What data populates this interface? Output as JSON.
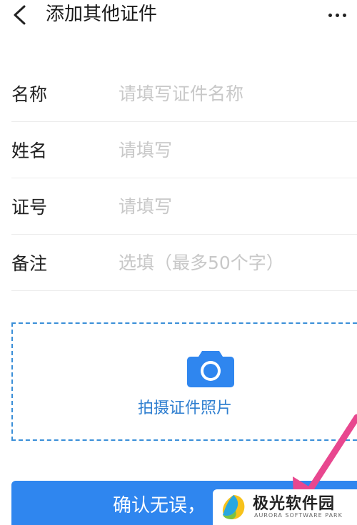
{
  "header": {
    "title": "添加其他证件"
  },
  "form": {
    "fields": [
      {
        "label": "名称",
        "placeholder": "请填写证件名称"
      },
      {
        "label": "姓名",
        "placeholder": "请填写"
      },
      {
        "label": "证号",
        "placeholder": "请填写"
      },
      {
        "label": "备注",
        "placeholder": "选填（最多50个字）"
      }
    ]
  },
  "photo": {
    "label": "拍摄证件照片"
  },
  "confirm_button": {
    "label": "确认无误，"
  },
  "watermark": {
    "name": "极光软件园",
    "subtitle": "AURORA SOFTWARE PARK"
  },
  "colors": {
    "accent": "#2f86ef",
    "photo_border": "#3a8fd8",
    "arrow": "#e8478f"
  },
  "icons": {
    "back": "chevron-left-icon",
    "more": "more-dots-icon",
    "camera": "camera-icon"
  }
}
